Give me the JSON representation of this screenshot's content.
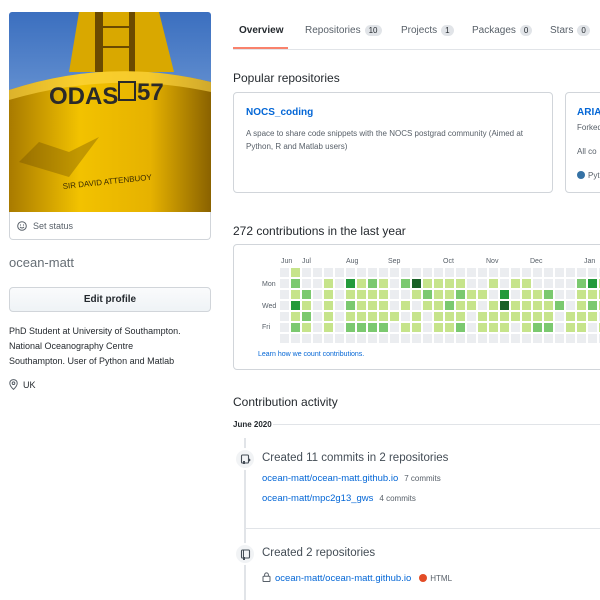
{
  "profile": {
    "avatar_sign_text": "ODAS",
    "avatar_number": "57",
    "avatar_caption": "SIR DAVID ATTENBUOY",
    "set_status": "Set status",
    "username": "ocean-matt",
    "edit_profile": "Edit profile",
    "bio_lines": [
      "PhD Student at University of Southampton.",
      "National Oceanography Centre",
      "Southampton. User of Python and Matlab"
    ],
    "location": "UK"
  },
  "tabs": [
    {
      "label": "Overview",
      "count": null,
      "active": true
    },
    {
      "label": "Repositories",
      "count": "10",
      "active": false
    },
    {
      "label": "Projects",
      "count": "1",
      "active": false
    },
    {
      "label": "Packages",
      "count": "0",
      "active": false
    },
    {
      "label": "Stars",
      "count": "0",
      "active": false
    }
  ],
  "popular": {
    "title": "Popular repositories",
    "repos": [
      {
        "name": "NOCS_coding",
        "description": "A space to share code snippets with the NOCS postgrad community (Aimed at Python, R and Matlab users)",
        "language": ""
      },
      {
        "name": "ARIA",
        "forked_text": "Forked",
        "extra_text": "All co",
        "language": "Pyth"
      }
    ]
  },
  "contributions": {
    "title": "272 contributions in the last year",
    "months": [
      "Jun",
      "Jul",
      "Aug",
      "Sep",
      "Oct",
      "Nov",
      "Dec",
      "Jan"
    ],
    "days": [
      "Mon",
      "Wed",
      "Fri"
    ],
    "learn_link": "Learn how we count contributions.",
    "grid": [
      [
        0,
        1,
        0,
        0,
        0,
        0,
        0,
        0,
        0,
        0,
        0,
        0,
        0,
        0,
        0,
        0,
        0,
        0,
        0,
        0,
        0,
        0,
        0,
        0,
        0,
        0,
        0,
        0,
        0,
        0,
        0,
        0,
        0,
        0,
        0,
        0,
        0,
        1,
        0,
        0
      ],
      [
        0,
        2,
        0,
        0,
        1,
        0,
        3,
        1,
        2,
        1,
        0,
        2,
        4,
        1,
        1,
        1,
        1,
        0,
        0,
        1,
        0,
        1,
        1,
        0,
        0,
        0,
        0,
        2,
        3,
        1,
        0,
        1,
        0,
        0,
        0,
        1,
        0,
        1,
        2,
        1
      ],
      [
        0,
        1,
        2,
        0,
        1,
        0,
        1,
        1,
        1,
        1,
        0,
        0,
        1,
        2,
        1,
        1,
        2,
        1,
        1,
        0,
        3,
        0,
        1,
        1,
        2,
        0,
        0,
        1,
        1,
        1,
        0,
        1,
        0,
        0,
        0,
        0,
        0,
        0,
        4,
        1
      ],
      [
        0,
        3,
        1,
        0,
        1,
        0,
        2,
        1,
        1,
        1,
        0,
        1,
        0,
        1,
        1,
        2,
        1,
        1,
        0,
        1,
        4,
        1,
        1,
        1,
        1,
        2,
        0,
        1,
        2,
        1,
        1,
        1,
        2,
        1,
        1,
        1,
        0,
        1,
        1,
        1
      ],
      [
        0,
        1,
        2,
        0,
        1,
        0,
        1,
        1,
        1,
        1,
        1,
        0,
        1,
        0,
        1,
        1,
        1,
        0,
        1,
        1,
        1,
        1,
        1,
        1,
        1,
        0,
        1,
        1,
        1,
        0,
        1,
        1,
        1,
        0,
        0,
        1,
        0,
        0,
        1,
        1
      ],
      [
        0,
        2,
        1,
        0,
        1,
        0,
        2,
        2,
        2,
        2,
        0,
        1,
        1,
        0,
        1,
        1,
        2,
        0,
        1,
        1,
        1,
        0,
        1,
        2,
        2,
        0,
        1,
        1,
        0,
        1,
        1,
        1,
        1,
        0,
        1,
        1,
        0,
        1,
        0,
        2
      ],
      [
        0,
        0,
        0,
        0,
        0,
        0,
        0,
        0,
        0,
        0,
        0,
        0,
        0,
        0,
        0,
        0,
        0,
        0,
        0,
        0,
        0,
        0,
        0,
        0,
        0,
        0,
        0,
        0,
        0,
        0,
        0,
        0,
        0,
        0,
        0,
        0,
        0,
        0,
        0,
        0
      ]
    ],
    "level_colors": [
      "#ebedf0",
      "#c6e48b",
      "#7bc96f",
      "#239a3b",
      "#196127"
    ]
  },
  "activity": {
    "title": "Contribution activity",
    "month": "June 2020",
    "events": [
      {
        "title": "Created 11 commits in 2 repositories",
        "repos": [
          {
            "name": "ocean-matt/ocean-matt.github.io",
            "commits": "7 commits"
          },
          {
            "name": "ocean-matt/mpc2g13_gws",
            "commits": "4 commits"
          }
        ]
      },
      {
        "title": "Created 2 repositories",
        "repos": [
          {
            "name": "ocean-matt/ocean-matt.github.io",
            "language": "HTML",
            "language_color": "#e34c26"
          }
        ]
      }
    ]
  },
  "colors": {
    "link": "#0366d6",
    "tab_underline": "#f9826c",
    "python": "#3572A5"
  }
}
